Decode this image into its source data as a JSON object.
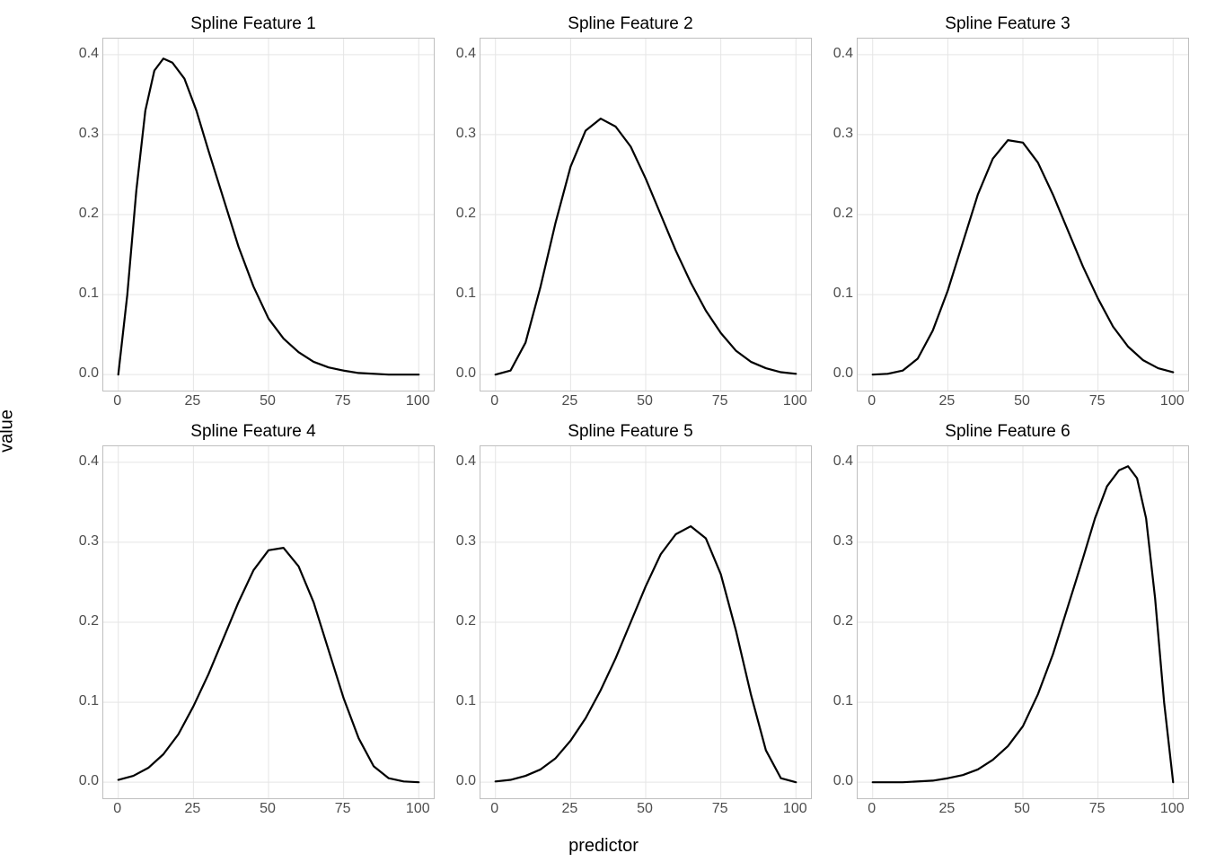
{
  "xlabel": "predictor",
  "ylabel": "value",
  "chart_data": [
    {
      "type": "line",
      "title": "Spline Feature 1",
      "xlim": [
        -5,
        105
      ],
      "ylim": [
        -0.02,
        0.42
      ],
      "xticks": [
        0,
        25,
        50,
        75,
        100
      ],
      "yticks": [
        0.0,
        0.1,
        0.2,
        0.3,
        0.4
      ],
      "x": [
        0,
        3,
        6,
        9,
        12,
        15,
        18,
        22,
        26,
        30,
        35,
        40,
        45,
        50,
        55,
        60,
        65,
        70,
        75,
        80,
        90,
        100
      ],
      "values": [
        0.0,
        0.1,
        0.23,
        0.33,
        0.38,
        0.395,
        0.39,
        0.37,
        0.33,
        0.28,
        0.22,
        0.16,
        0.11,
        0.07,
        0.045,
        0.028,
        0.016,
        0.009,
        0.005,
        0.002,
        0.0,
        0.0
      ]
    },
    {
      "type": "line",
      "title": "Spline Feature 2",
      "xlim": [
        -5,
        105
      ],
      "ylim": [
        -0.02,
        0.42
      ],
      "xticks": [
        0,
        25,
        50,
        75,
        100
      ],
      "yticks": [
        0.0,
        0.1,
        0.2,
        0.3,
        0.4
      ],
      "x": [
        0,
        5,
        10,
        15,
        20,
        25,
        30,
        35,
        40,
        45,
        50,
        55,
        60,
        65,
        70,
        75,
        80,
        85,
        90,
        95,
        100
      ],
      "values": [
        0.0,
        0.005,
        0.04,
        0.11,
        0.19,
        0.26,
        0.305,
        0.32,
        0.31,
        0.285,
        0.245,
        0.2,
        0.155,
        0.115,
        0.08,
        0.052,
        0.03,
        0.016,
        0.008,
        0.003,
        0.001
      ]
    },
    {
      "type": "line",
      "title": "Spline Feature 3",
      "xlim": [
        -5,
        105
      ],
      "ylim": [
        -0.02,
        0.42
      ],
      "xticks": [
        0,
        25,
        50,
        75,
        100
      ],
      "yticks": [
        0.0,
        0.1,
        0.2,
        0.3,
        0.4
      ],
      "x": [
        0,
        5,
        10,
        15,
        20,
        25,
        30,
        35,
        40,
        45,
        50,
        55,
        60,
        65,
        70,
        75,
        80,
        85,
        90,
        95,
        100
      ],
      "values": [
        0.0,
        0.001,
        0.005,
        0.02,
        0.055,
        0.105,
        0.165,
        0.225,
        0.27,
        0.293,
        0.29,
        0.265,
        0.225,
        0.18,
        0.135,
        0.095,
        0.06,
        0.035,
        0.018,
        0.008,
        0.003
      ]
    },
    {
      "type": "line",
      "title": "Spline Feature 4",
      "xlim": [
        -5,
        105
      ],
      "ylim": [
        -0.02,
        0.42
      ],
      "xticks": [
        0,
        25,
        50,
        75,
        100
      ],
      "yticks": [
        0.0,
        0.1,
        0.2,
        0.3,
        0.4
      ],
      "x": [
        0,
        5,
        10,
        15,
        20,
        25,
        30,
        35,
        40,
        45,
        50,
        55,
        60,
        65,
        70,
        75,
        80,
        85,
        90,
        95,
        100
      ],
      "values": [
        0.003,
        0.008,
        0.018,
        0.035,
        0.06,
        0.095,
        0.135,
        0.18,
        0.225,
        0.265,
        0.29,
        0.293,
        0.27,
        0.225,
        0.165,
        0.105,
        0.055,
        0.02,
        0.005,
        0.001,
        0.0
      ]
    },
    {
      "type": "line",
      "title": "Spline Feature 5",
      "xlim": [
        -5,
        105
      ],
      "ylim": [
        -0.02,
        0.42
      ],
      "xticks": [
        0,
        25,
        50,
        75,
        100
      ],
      "yticks": [
        0.0,
        0.1,
        0.2,
        0.3,
        0.4
      ],
      "x": [
        0,
        5,
        10,
        15,
        20,
        25,
        30,
        35,
        40,
        45,
        50,
        55,
        60,
        65,
        70,
        75,
        80,
        85,
        90,
        95,
        100
      ],
      "values": [
        0.001,
        0.003,
        0.008,
        0.016,
        0.03,
        0.052,
        0.08,
        0.115,
        0.155,
        0.2,
        0.245,
        0.285,
        0.31,
        0.32,
        0.305,
        0.26,
        0.19,
        0.11,
        0.04,
        0.005,
        0.0
      ]
    },
    {
      "type": "line",
      "title": "Spline Feature 6",
      "xlim": [
        -5,
        105
      ],
      "ylim": [
        -0.02,
        0.42
      ],
      "xticks": [
        0,
        25,
        50,
        75,
        100
      ],
      "yticks": [
        0.0,
        0.1,
        0.2,
        0.3,
        0.4
      ],
      "x": [
        0,
        10,
        20,
        25,
        30,
        35,
        40,
        45,
        50,
        55,
        60,
        65,
        70,
        74,
        78,
        82,
        85,
        88,
        91,
        94,
        97,
        100
      ],
      "values": [
        0.0,
        0.0,
        0.002,
        0.005,
        0.009,
        0.016,
        0.028,
        0.045,
        0.07,
        0.11,
        0.16,
        0.22,
        0.28,
        0.33,
        0.37,
        0.39,
        0.395,
        0.38,
        0.33,
        0.23,
        0.1,
        0.0
      ]
    }
  ]
}
